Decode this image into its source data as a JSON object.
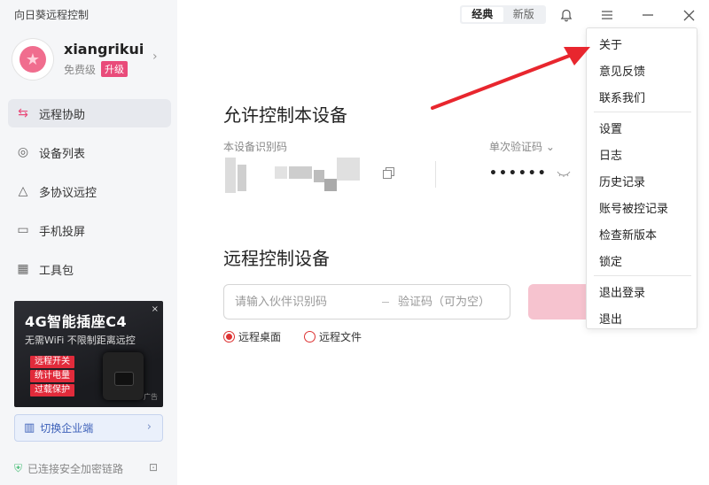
{
  "app": {
    "title": "向日葵远程控制"
  },
  "user": {
    "name": "xiangrikui",
    "tier": "免费级",
    "upgrade": "升级"
  },
  "nav": [
    {
      "label": "远程协助",
      "icon": "remote-assist-icon",
      "active": true
    },
    {
      "label": "设备列表",
      "icon": "device-list-icon"
    },
    {
      "label": "多协议远控",
      "icon": "multi-protocol-icon"
    },
    {
      "label": "手机投屏",
      "icon": "screen-cast-icon"
    },
    {
      "label": "工具包",
      "icon": "toolkit-icon"
    }
  ],
  "ad": {
    "title": "4G智能插座C4",
    "subtitle": "无需WiFi 不限制距离远控",
    "tags": [
      "远程开关",
      "统计电量",
      "过载保护"
    ],
    "close": "×",
    "label": "广告"
  },
  "sidebar_footer": {
    "enterprise": "切换企业端",
    "status": "已连接安全加密链路"
  },
  "topbar": {
    "mode_classic": "经典",
    "mode_new": "新版"
  },
  "allow": {
    "title": "允许控制本设备",
    "id_label": "本设备识别码",
    "code_label": "单次验证码",
    "code_value": "••••••"
  },
  "remote": {
    "title": "远程控制设备",
    "id_placeholder": "请输入伙伴识别码",
    "code_placeholder": "验证码（可为空）",
    "options": [
      "远程桌面",
      "远程文件"
    ]
  },
  "menu": {
    "group1": [
      "关于",
      "意见反馈",
      "联系我们"
    ],
    "group2": [
      "设置",
      "日志",
      "历史记录",
      "账号被控记录",
      "检查新版本",
      "锁定"
    ],
    "group3": [
      "退出登录",
      "退出"
    ]
  },
  "colors": {
    "accent": "#e94b7a",
    "arrow": "#e8262e"
  }
}
